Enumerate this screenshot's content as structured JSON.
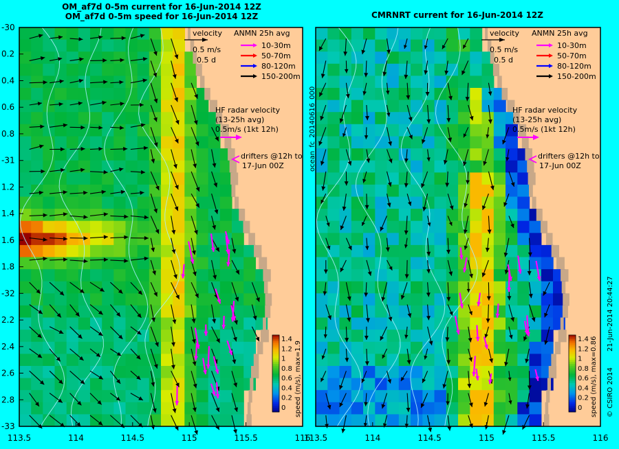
{
  "left_panel": {
    "title_line1": "OM_af7d 0-5m current for 16-Jun-2014 12Z",
    "title_line2": "OM_af7d 0-5m speed for 16-Jun-2014 12Z",
    "velocity_label": "velocity",
    "scale_speed": "0.5 m/s",
    "scale_time": "0.5 d",
    "legend_title": "ANMN 25h avg",
    "legend_items": [
      {
        "label": "10-30m",
        "color": "#ff00ff"
      },
      {
        "label": "50-70m",
        "color": "#ff0000"
      },
      {
        "label": "80-120m",
        "color": "#0000ff"
      },
      {
        "label": "150-200m",
        "color": "#000000"
      }
    ],
    "hf_line1": "HF radar velocity",
    "hf_line2": "(13-25h avg)",
    "hf_line3": "0.5m/s (1kt 12h)",
    "drifters_line1": "drifters @12h to",
    "drifters_line2": "17-Jun 00Z",
    "colorbar_label": "speed (m/s), max=1.9"
  },
  "right_panel": {
    "title": "CMRNRT current for 16-Jun-2014 12Z",
    "velocity_label": "velocity",
    "scale_speed": "0.5 m/s",
    "scale_time": "0.5 d",
    "legend_title": "ANMN 25h avg",
    "legend_items": [
      {
        "label": "10-30m",
        "color": "#ff00ff"
      },
      {
        "label": "50-70m",
        "color": "#ff0000"
      },
      {
        "label": "80-120m",
        "color": "#0000ff"
      },
      {
        "label": "150-200m",
        "color": "#000000"
      }
    ],
    "hf_line1": "HF radar velocity",
    "hf_line2": "(13-25h avg)",
    "hf_line3": "0.5m/s (1kt 12h)",
    "drifters_line1": "drifters @12h to",
    "drifters_line2": "17-Jun 00Z",
    "colorbar_label": "speed (m/s), max=0.86",
    "forecast_label": "ocean_fc_20140616_000"
  },
  "y_tick_labels": [
    "-30",
    "0.2",
    "0.4",
    "0.6",
    "0.8",
    "-31",
    "1.2",
    "1.4",
    "1.6",
    "1.8",
    "-32",
    "2.2",
    "2.4",
    "2.6",
    "2.8",
    "-33"
  ],
  "x_tick_labels_left": [
    "113.5",
    "114",
    "114.5",
    "115",
    "115.5",
    "116"
  ],
  "x_tick_labels_right": [
    "113.5",
    "114",
    "114.5",
    "115",
    "115.5",
    "116"
  ],
  "colorbar_ticks": [
    "1.4",
    "1.2",
    "1",
    "0.8",
    "0.6",
    "0.4",
    "0.2",
    "0"
  ],
  "copyright": "© CSIRO 2014",
  "timestamp": "21-Jun-2014 20:44:27",
  "colors": {
    "background": "#00ffff",
    "land": "#ffcc99",
    "coast": "#c8a888"
  }
}
